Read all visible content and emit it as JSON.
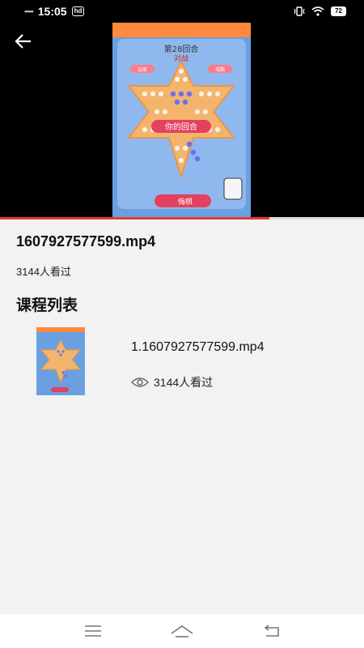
{
  "status_bar": {
    "time": "15:05",
    "hd_badge": "hd",
    "battery": "72"
  },
  "video": {
    "progress_percent": 74,
    "game_round_text": "第28回合",
    "game_subtitle": "对战",
    "player_label": "玩家",
    "computer_label": "电脑",
    "turn_text": "你的回合",
    "button_text": "悔棋"
  },
  "info": {
    "title": "1607927577599.mp4",
    "views": "3144人看过"
  },
  "course_list": {
    "heading": "课程列表",
    "items": [
      {
        "title": "1.1607927577599.mp4",
        "views": "3144人看过"
      }
    ]
  },
  "colors": {
    "progress": "#e53935",
    "video_bg": "#000000",
    "page_bg": "#f2f2f2"
  }
}
